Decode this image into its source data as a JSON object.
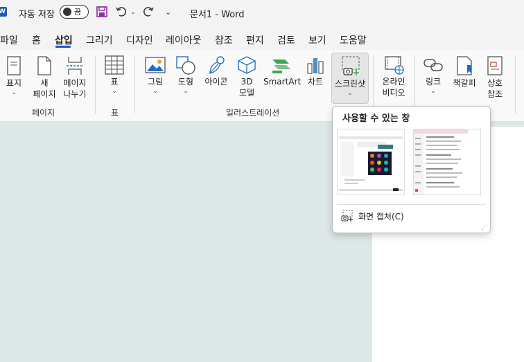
{
  "titlebar": {
    "app_logo": "W",
    "autosave_label": "자동 저장",
    "autosave_toggle": "끔",
    "doc_title": "문서1 -  Word",
    "icons": [
      "save-icon",
      "undo-icon",
      "redo-icon",
      "customize-icon"
    ]
  },
  "menu": {
    "tabs": [
      "파일",
      "홈",
      "삽입",
      "그리기",
      "디자인",
      "레이아웃",
      "참조",
      "편지",
      "검토",
      "보기",
      "도움말"
    ],
    "active_tab": "삽입"
  },
  "ribbon": {
    "cover_page": "표지",
    "new_page_1": "새",
    "new_page_2": "페이지",
    "page_break_1": "페이지",
    "page_break_2": "나누기",
    "group_pages": "페이지",
    "table": "표",
    "group_table": "표",
    "pictures": "그림",
    "shapes": "도형",
    "icons": "아이콘",
    "models_1": "3D",
    "models_2": "모델",
    "smartart": "SmartArt",
    "chart": "차트",
    "screenshot": "스크린샷",
    "group_illustrations": "일러스트레이션",
    "online_video_1": "온라인",
    "online_video_2": "비디오",
    "link": "링크",
    "bookmark": "책갈피",
    "crossref_1": "상호",
    "crossref_2": "참조"
  },
  "popup": {
    "title": "사용할 수 있는 창",
    "capture_label": "화면 캡처(C)"
  },
  "colors": {
    "accent": "#185abd",
    "doc_background": "#dde7e8",
    "smartart_green": "#3aa655",
    "chart_blue": "#4a90c8"
  }
}
